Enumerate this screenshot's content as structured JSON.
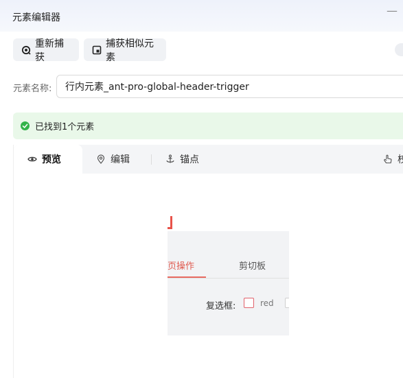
{
  "window": {
    "title": "元素编辑器",
    "minimize_label": "—"
  },
  "toolbar": {
    "recapture_label": "重新捕获",
    "capture_similar_label": "捕获相似元素"
  },
  "element_name": {
    "label": "元素名称:",
    "value": "行内元素_ant-pro-global-header-trigger"
  },
  "alert": {
    "text": "已找到1个元素"
  },
  "tabs": [
    {
      "label": "预览",
      "icon": "eye-icon"
    },
    {
      "label": "编辑",
      "icon": "location-pin-icon"
    },
    {
      "label": "锚点",
      "icon": "anchor-icon"
    },
    {
      "label": "校",
      "icon": "hand-pointer-icon"
    }
  ],
  "preview": {
    "tab_active": "页操作",
    "tab_other": "剪切板",
    "checkbox_label": "复选框:",
    "checkbox_option": "red"
  },
  "colors": {
    "accent_green": "#33b34a",
    "alert_bg": "#e9f8e9",
    "preview_red": "#e05a4f"
  }
}
